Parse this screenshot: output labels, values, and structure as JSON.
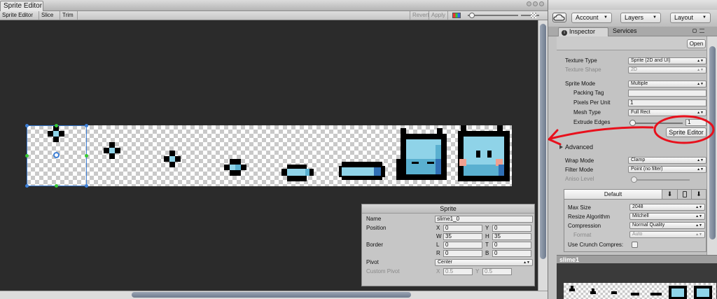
{
  "editor": {
    "tab_title": "Sprite Editor",
    "toolbar": {
      "mode_label": "Sprite Editor ▾",
      "slice_label": "Slice ▾",
      "trim_label": "Trim",
      "revert_label": "Revert",
      "apply_label": "Apply"
    }
  },
  "sprite_panel": {
    "title": "Sprite",
    "name_label": "Name",
    "name_value": "slime1_0",
    "position_label": "Position",
    "x_label": "X",
    "x_value": "0",
    "y_label": "Y",
    "y_value": "0",
    "w_label": "W",
    "w_value": "35",
    "h_label": "H",
    "h_value": "35",
    "border_label": "Border",
    "l_label": "L",
    "l_value": "0",
    "t_label": "T",
    "t_value": "0",
    "r_label": "R",
    "r_value": "0",
    "b_label": "B",
    "b_value": "0",
    "pivot_label": "Pivot",
    "pivot_value": "Center",
    "custom_pivot_label": "Custom Pivot",
    "cx_label": "X",
    "cx_value": "0.5",
    "cy_label": "Y",
    "cy_value": "0.5"
  },
  "top_bar": {
    "account_label": "Account",
    "layers_label": "Layers",
    "layout_label": "Layout"
  },
  "tabs": {
    "inspector": "Inspector",
    "services": "Services"
  },
  "inspector": {
    "open_label": "Open",
    "texture_type_label": "Texture Type",
    "texture_type_value": "Sprite (2D and UI)",
    "texture_shape_label": "Texture Shape",
    "texture_shape_value": "2D",
    "sprite_mode_label": "Sprite Mode",
    "sprite_mode_value": "Multiple",
    "packing_tag_label": "Packing Tag",
    "packing_tag_value": "",
    "ppu_label": "Pixels Per Unit",
    "ppu_value": "1",
    "mesh_type_label": "Mesh Type",
    "mesh_type_value": "Full Rect",
    "extrude_label": "Extrude Edges",
    "extrude_value": "1",
    "sprite_editor_button": "Sprite Editor",
    "advanced_label": "Advanced",
    "wrap_label": "Wrap Mode",
    "wrap_value": "Clamp",
    "filter_label": "Filter Mode",
    "filter_value": "Point (no filter)",
    "aniso_label": "Aniso Level",
    "platform_default": "Default",
    "max_size_label": "Max Size",
    "max_size_value": "2048",
    "resize_label": "Resize Algorithm",
    "resize_value": "Mitchell",
    "compression_label": "Compression",
    "compression_value": "Normal Quality",
    "format_label": "Format",
    "format_value": "Auto",
    "crunch_label": "Use Crunch Compres:"
  },
  "preview": {
    "title": "slime1"
  },
  "colors": {
    "annotation_red": "#e8101c",
    "selection_blue": "#3d7fd6",
    "slime_light": "#8fd3e8",
    "slime_mid": "#5ab0d0",
    "slime_dark": "#2f6fb5",
    "cheek_pink": "#f0a090"
  }
}
